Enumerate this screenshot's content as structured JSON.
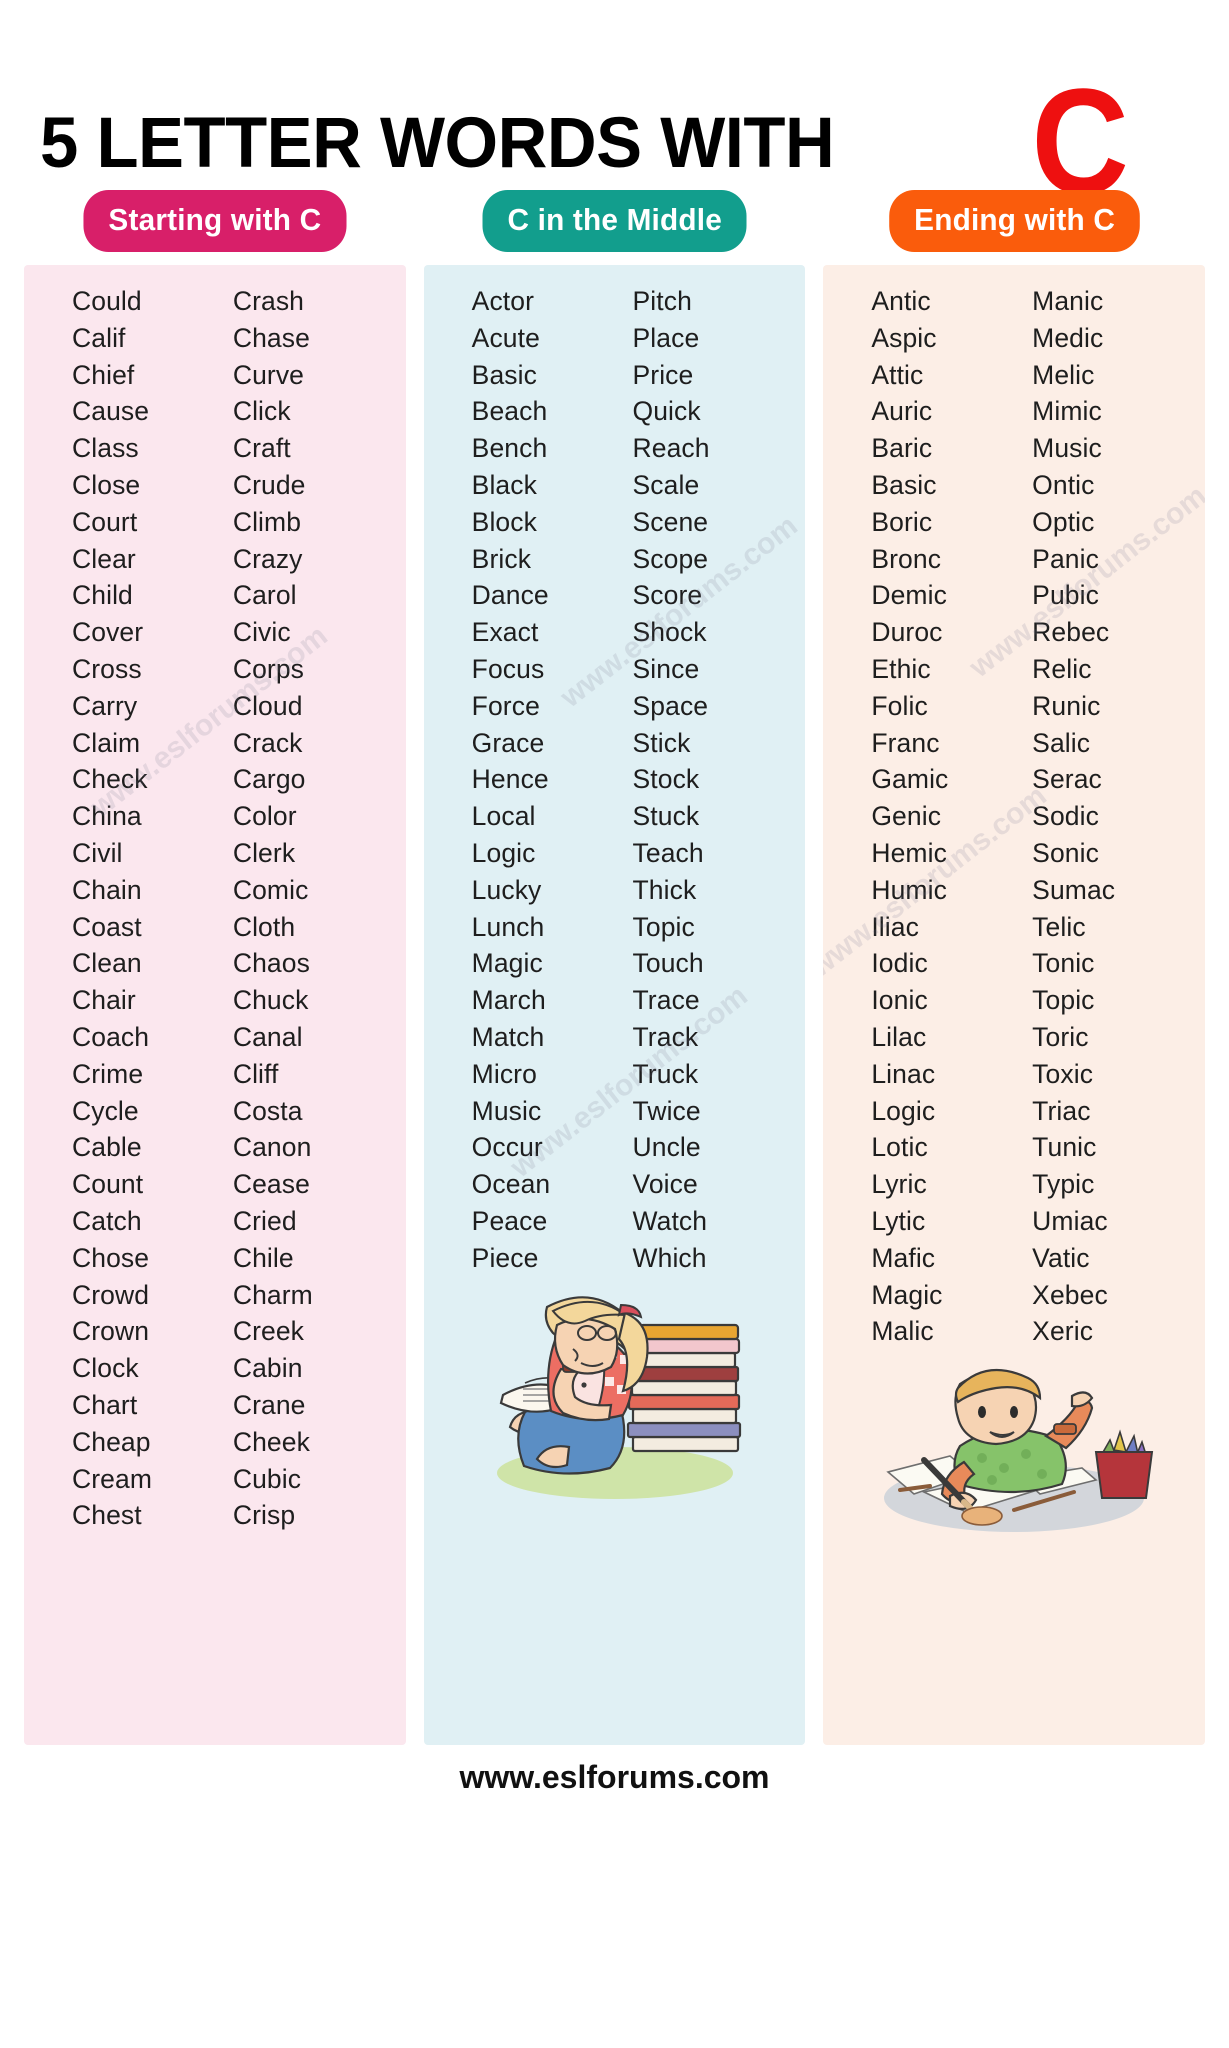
{
  "header": {
    "title": "5 LETTER WORDS WITH",
    "letter": "C",
    "letter_color": "#ee1010"
  },
  "columns": [
    {
      "badge_label": "Starting with C",
      "badge_color": "#d81f69",
      "panel_color": "#fbe7ee",
      "watermark": "www.eslforums.com",
      "col_a": [
        "Could",
        "Calif",
        "Chief",
        "Cause",
        "Class",
        "Close",
        "Court",
        "Clear",
        "Child",
        "Cover",
        "Cross",
        "Carry",
        "Claim",
        "Check",
        "China",
        "Civil",
        "Chain",
        "Coast",
        "Clean",
        "Chair",
        "Coach",
        "Crime",
        "Cycle",
        "Cable",
        "Count",
        "Catch",
        "Chose",
        "Crowd",
        "Crown",
        "Clock",
        "Chart",
        "Cheap",
        "Cream",
        "Chest"
      ],
      "col_b": [
        "Crash",
        "Chase",
        "Curve",
        "Click",
        "Craft",
        "Crude",
        "Climb",
        "Crazy",
        "Carol",
        "Civic",
        "Corps",
        "Cloud",
        "Crack",
        "Cargo",
        "Color",
        "Clerk",
        "Comic",
        "Cloth",
        "Chaos",
        "Chuck",
        "Canal",
        "Cliff",
        "Costa",
        "Canon",
        "Cease",
        "Cried",
        "Chile",
        "Charm",
        "Creek",
        "Cabin",
        "Crane",
        "Cheek",
        "Cubic",
        "Crisp"
      ],
      "illustration": "none"
    },
    {
      "badge_label": "C in the Middle",
      "badge_color": "#129e8d",
      "panel_color": "#e0f0f4",
      "watermark": "www.eslforums.com",
      "col_a": [
        "Actor",
        "Acute",
        "Basic",
        "Beach",
        "Bench",
        "Black",
        "Block",
        "Brick",
        "Dance",
        "Exact",
        "Focus",
        "Force",
        "Grace",
        "Hence",
        "Local",
        "Logic",
        "Lucky",
        "Lunch",
        "Magic",
        "March",
        "Match",
        "Micro",
        "Music",
        "Occur",
        "Ocean",
        "Peace",
        "Piece"
      ],
      "col_b": [
        "Pitch",
        "Place",
        "Price",
        "Quick",
        "Reach",
        "Scale",
        "Scene",
        "Scope",
        "Score",
        "Shock",
        "Since",
        "Space",
        "Stick",
        "Stock",
        "Stuck",
        "Teach",
        "Thick",
        "Topic",
        "Touch",
        "Trace",
        "Track",
        "Truck",
        "Twice",
        "Uncle",
        "Voice",
        "Watch",
        "Which"
      ],
      "illustration": "girl-reading-books"
    },
    {
      "badge_label": "Ending with C",
      "badge_color": "#fa5c0c",
      "panel_color": "#fceee6",
      "watermark": "www.eslforums.com",
      "col_a": [
        "Antic",
        "Aspic",
        "Attic",
        "Auric",
        "Baric",
        "Basic",
        "Boric",
        "Bronc",
        "Demic",
        "Duroc",
        "Ethic",
        "Folic",
        "Franc",
        "Gamic",
        "Genic",
        "Hemic",
        "Humic",
        "Iliac",
        "Iodic",
        "Ionic",
        "Lilac",
        "Linac",
        "Logic",
        "Lotic",
        "Lyric",
        "Lytic",
        "Mafic",
        "Magic",
        "Malic"
      ],
      "col_b": [
        "Manic",
        "Medic",
        "Melic",
        "Mimic",
        "Music",
        "Ontic",
        "Optic",
        "Panic",
        "Pubic",
        "Rebec",
        "Relic",
        "Runic",
        "Salic",
        "Serac",
        "Sodic",
        "Sonic",
        "Sumac",
        "Telic",
        "Tonic",
        "Topic",
        "Toric",
        "Toxic",
        "Triac",
        "Tunic",
        "Typic",
        "Umiac",
        "Vatic",
        "Xebec",
        "Xeric"
      ],
      "illustration": "boy-drawing"
    }
  ],
  "footer": {
    "site": "www.eslforums.com"
  }
}
